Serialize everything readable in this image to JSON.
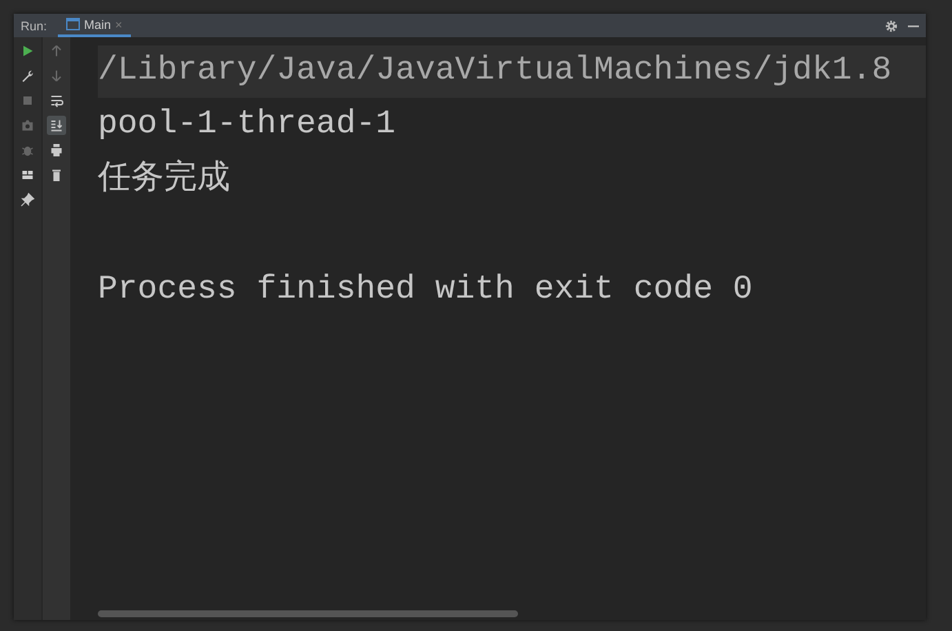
{
  "header": {
    "label": "Run:",
    "tabs": [
      {
        "label": "Main",
        "selected": true,
        "close": "×"
      }
    ]
  },
  "left_toolbar": [
    {
      "kind": "run",
      "disabled": false
    },
    {
      "kind": "wrench",
      "disabled": false
    },
    {
      "kind": "stop",
      "disabled": true
    },
    {
      "kind": "camera",
      "disabled": true
    },
    {
      "kind": "bug",
      "disabled": true
    },
    {
      "kind": "layout",
      "disabled": false
    },
    {
      "kind": "pin",
      "disabled": false
    }
  ],
  "console_toolbar": [
    {
      "kind": "up",
      "disabled": true,
      "on": false
    },
    {
      "kind": "down",
      "disabled": true,
      "on": false
    },
    {
      "kind": "wrap",
      "disabled": false,
      "on": false
    },
    {
      "kind": "scroll-end",
      "disabled": false,
      "on": true
    },
    {
      "kind": "print",
      "disabled": false,
      "on": false
    },
    {
      "kind": "trash",
      "disabled": false,
      "on": false
    }
  ],
  "console": {
    "lines": [
      {
        "text": "/Library/Java/JavaVirtualMachines/jdk1.8",
        "kind": "command"
      },
      {
        "text": "pool-1-thread-1",
        "kind": "output"
      },
      {
        "text": "任务完成",
        "kind": "output"
      },
      {
        "kind": "blank"
      },
      {
        "text": "Process finished with exit code 0",
        "kind": "output"
      }
    ]
  }
}
